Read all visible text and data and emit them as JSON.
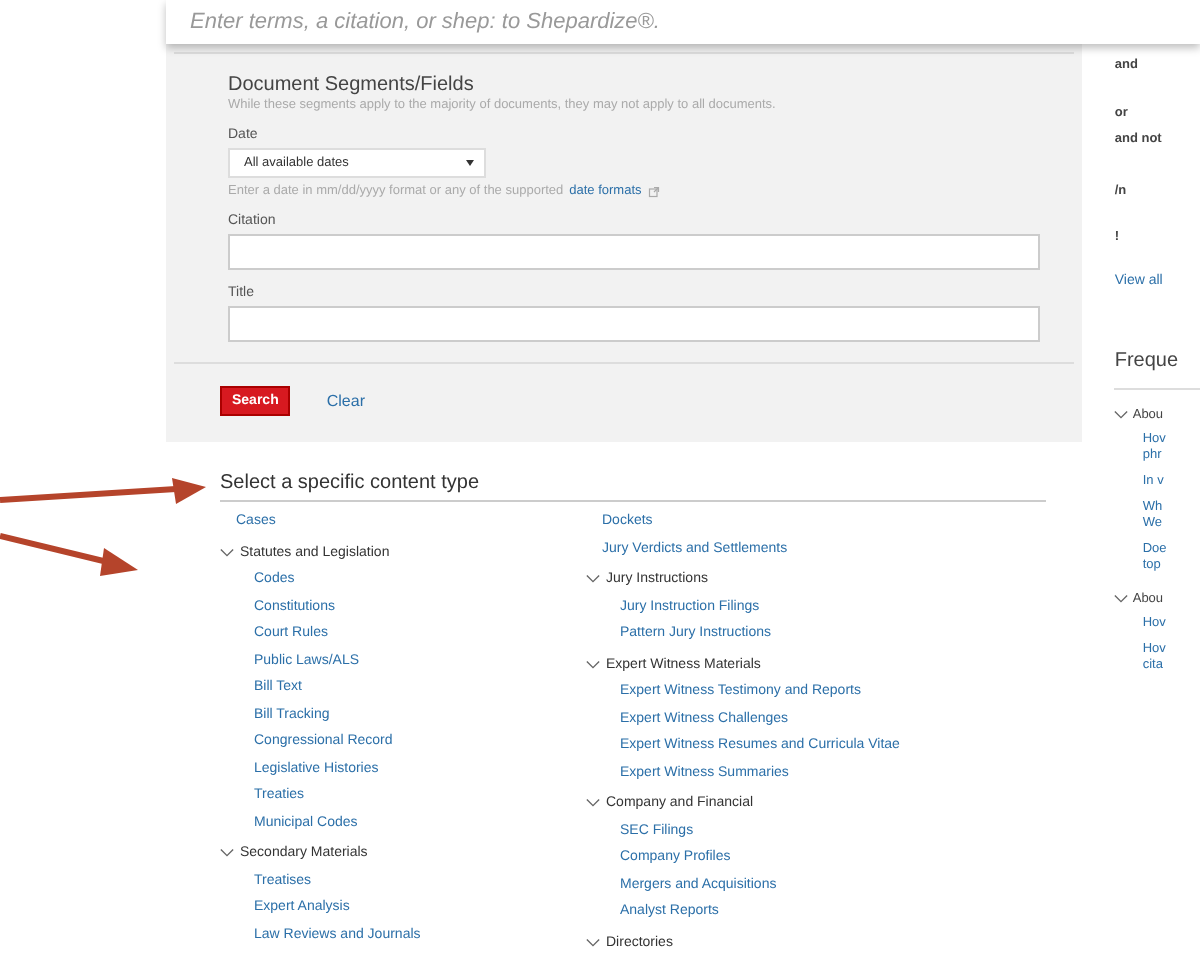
{
  "search_bar": {
    "placeholder": "Enter terms, a citation, or shep: to Shepardize®."
  },
  "segments": {
    "title": "Document Segments/Fields",
    "subtitle": "While these segments apply to the majority of documents, they may not apply to all documents.",
    "date_label": "Date",
    "date_value": "All available dates",
    "date_hint": "Enter a date in mm/dd/yyyy format or any of the supported",
    "date_link": "date formats",
    "citation_label": "Citation",
    "title_label": "Title",
    "search_button": "Search",
    "clear_link": "Clear"
  },
  "content_types": {
    "heading": "Select a specific content type",
    "columns": [
      [
        {
          "kind": "link",
          "label": "Cases"
        },
        {
          "kind": "group",
          "label": "Statutes and Legislation",
          "expanded": true,
          "children": [
            "Codes",
            "Constitutions",
            "Court Rules",
            "Public Laws/ALS",
            "Bill Text",
            "Bill Tracking",
            "Congressional Record",
            "Legislative Histories",
            "Treaties",
            "Municipal Codes"
          ]
        },
        {
          "kind": "group",
          "label": "Secondary Materials",
          "expanded": true,
          "children": [
            "Treatises",
            "Expert Analysis",
            "Law Reviews and Journals"
          ]
        }
      ],
      [
        {
          "kind": "link",
          "label": "Dockets"
        },
        {
          "kind": "link",
          "label": "Jury Verdicts and Settlements"
        },
        {
          "kind": "group",
          "label": "Jury Instructions",
          "expanded": true,
          "children": [
            "Jury Instruction Filings",
            "Pattern Jury Instructions"
          ]
        },
        {
          "kind": "group",
          "label": "Expert Witness Materials",
          "expanded": true,
          "children": [
            "Expert Witness Testimony and Reports",
            "Expert Witness Challenges",
            "Expert Witness Resumes and Curricula Vitae",
            "Expert Witness Summaries"
          ]
        },
        {
          "kind": "group",
          "label": "Company and Financial",
          "expanded": true,
          "children": [
            "SEC Filings",
            "Company Profiles",
            "Mergers and Acquisitions",
            "Analyst Reports"
          ]
        },
        {
          "kind": "group",
          "label": "Directories",
          "expanded": true
        }
      ]
    ]
  },
  "right_panel": {
    "connectors": [
      "and",
      "or",
      "and not",
      "/n",
      "!"
    ],
    "view_all": "View all",
    "faq_title": "Freque",
    "faq_groups": [
      {
        "title": "Abou",
        "expanded": true,
        "items": [
          [
            "Hov",
            "phr"
          ],
          [
            "In v"
          ],
          [
            "Wh",
            "We"
          ],
          [
            "Doe",
            "top"
          ]
        ]
      },
      {
        "title": "Abou",
        "expanded": true,
        "items": [
          [
            "Hov"
          ],
          [
            "Hov",
            "cita"
          ]
        ]
      }
    ]
  }
}
